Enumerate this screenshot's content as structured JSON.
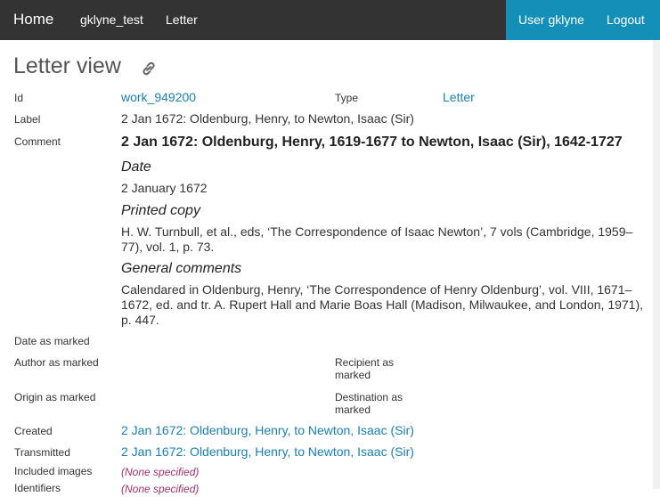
{
  "nav": {
    "home": "Home",
    "collection": "gklyne_test",
    "type": "Letter",
    "user": "User gklyne",
    "logout": "Logout"
  },
  "page": {
    "title": "Letter view"
  },
  "fields": {
    "id_label": "Id",
    "id_value": "work_949200",
    "type_label": "Type",
    "type_value": "Letter",
    "label_label": "Label",
    "label_value": "2 Jan 1672: Oldenburg, Henry, to Newton, Isaac (Sir)",
    "comment_label": "Comment",
    "date_as_marked_label": "Date as marked",
    "author_as_marked_label": "Author as marked",
    "recipient_as_marked_label": "Recipient as marked",
    "origin_as_marked_label": "Origin as marked",
    "destination_as_marked_label": "Destination as marked",
    "created_label": "Created",
    "created_value": "2 Jan 1672: Oldenburg, Henry, to Newton, Isaac (Sir)",
    "transmitted_label": "Transmitted",
    "transmitted_value": "2 Jan 1672: Oldenburg, Henry, to Newton, Isaac (Sir)",
    "included_images_label": "Included images",
    "included_images_value": "(None specified)",
    "identifiers_label": "Identifiers",
    "identifiers_value": "(None specified)"
  },
  "comment": {
    "title": "2 Jan 1672: Oldenburg, Henry, 1619-1677 to Newton, Isaac (Sir), 1642-1727",
    "date_heading": "Date",
    "date_text": "2 January 1672",
    "printed_heading": "Printed copy",
    "printed_text": "H. W. Turnbull, et al., eds, ‘The Correspondence of Isaac Newton’, 7 vols (Cambridge, 1959–77), vol. 1, p. 73.",
    "general_heading": "General comments",
    "general_text": "Calendared in Oldenburg, Henry, ‘The Correspondence of Henry Oldenburg’, vol. VIII, 1671–1672, ed. and tr. A. Rupert Hall and Marie Boas Hall (Madison, Milwaukee, and London, 1971), p. 447."
  },
  "icons": {
    "permalink": "link-icon"
  },
  "colors": {
    "navbar": "#333333",
    "user_bar": "#1490b8",
    "link": "#1a7fb0",
    "none_specified": "#a0326a"
  }
}
